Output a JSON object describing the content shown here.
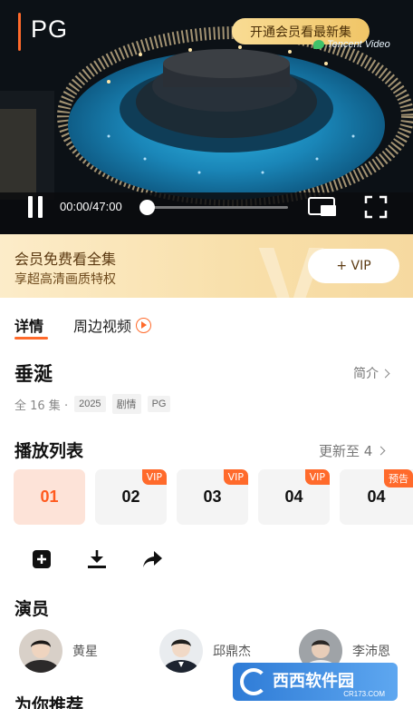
{
  "player": {
    "rating": "PG",
    "vip_button": "开通会员看最新集",
    "watermark": "Tencent Video",
    "time": "00:00/47:00",
    "progress": 0.0
  },
  "banner": {
    "title": "会员免费看全集",
    "subtitle": "享超高清画质特权",
    "button": "+ VIP"
  },
  "tabs": [
    {
      "label": "详情",
      "active": true
    },
    {
      "label": "周边视频",
      "active": false
    }
  ],
  "show": {
    "title": "垂涎",
    "intro_link": "简介",
    "episode_count": "全 16 集 ·",
    "tags": [
      "2025",
      "剧情",
      "PG"
    ]
  },
  "playlist": {
    "title": "播放列表",
    "update_text": "更新至 4",
    "episodes": [
      {
        "label": "01",
        "badge": ""
      },
      {
        "label": "02",
        "badge": "VIP"
      },
      {
        "label": "03",
        "badge": "VIP"
      },
      {
        "label": "04",
        "badge": "VIP"
      },
      {
        "label": "04",
        "badge": "预告"
      }
    ]
  },
  "actions": [
    "add-icon",
    "download-icon",
    "share-icon"
  ],
  "cast": {
    "title": "演员",
    "actors": [
      {
        "name": "黄星"
      },
      {
        "name": "邱鼎杰"
      },
      {
        "name": "李沛恩"
      }
    ]
  },
  "recommend": {
    "title": "为你推荐"
  },
  "site_watermark": {
    "text": "西西软件园",
    "url": "CR173.COM"
  },
  "colors": {
    "accent": "#ff6a2b",
    "vip_gold": "#f0c567",
    "banner_bg": "#fcecc9"
  }
}
